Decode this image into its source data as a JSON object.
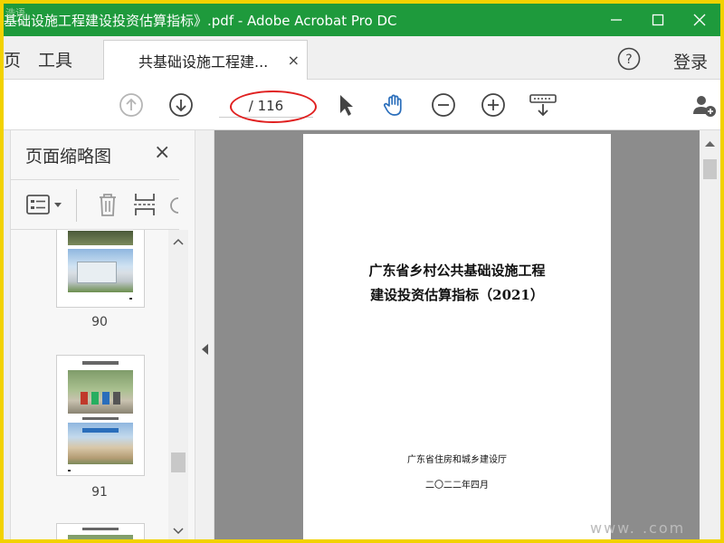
{
  "window": {
    "title": "基础设施工程建设投资估算指标》.pdf - Adobe Acrobat Pro DC",
    "watermark_top": "浩语",
    "watermark_bottom": "www.        .com"
  },
  "tabs": {
    "home_partial": "页",
    "tools": "工具",
    "document": "共基础设施工程建...",
    "close_symbol": "×",
    "help_symbol": "?",
    "login": "登录"
  },
  "toolbar": {
    "page_total": "/ 116"
  },
  "thumbnail_panel": {
    "title": "页面缩略图",
    "close_symbol": "×",
    "pages": [
      {
        "number": "90"
      },
      {
        "number": "91"
      }
    ]
  },
  "document": {
    "title_line1": "广东省乡村公共基础设施工程",
    "title_line2": "建设投资估算指标（2021）",
    "issuer": "广东省住房和城乡建设厅",
    "date": "二〇二二年四月"
  },
  "colors": {
    "titlebar": "#1e9a3c",
    "accent_blue": "#2a6ebb",
    "highlight_red": "#e02020",
    "frame_yellow": "#f2d200"
  }
}
